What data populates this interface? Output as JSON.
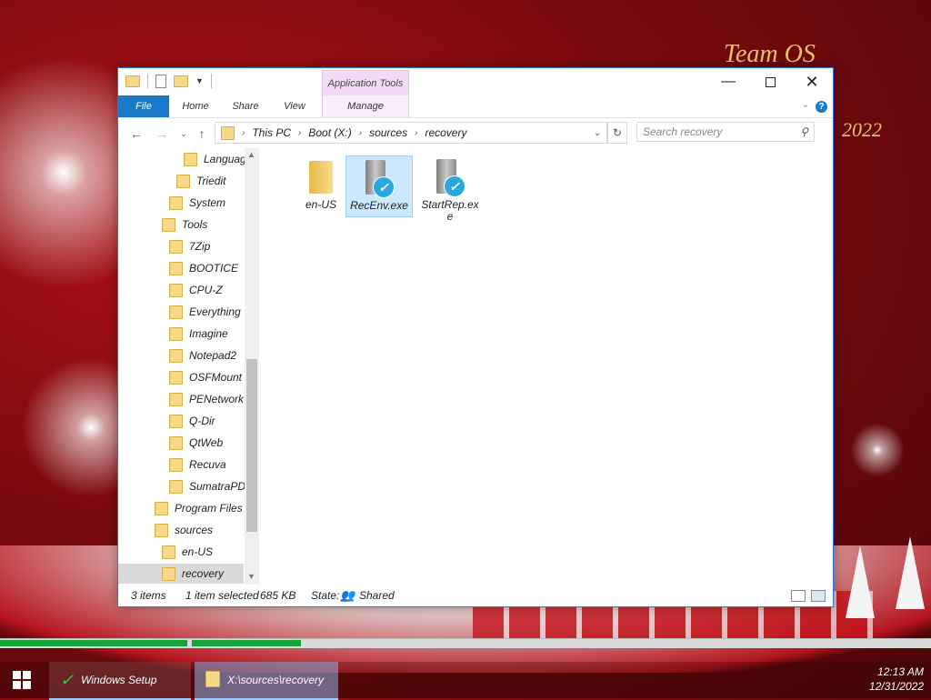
{
  "desktop": {
    "watermark_top": "Team OS",
    "watermark_year": "2022"
  },
  "window": {
    "quick_access_icons": [
      "folder-icon",
      "document-icon",
      "folder-icon",
      "dropdown-icon"
    ],
    "context_tab_group": "Application Tools",
    "ribbon_tabs": [
      "File",
      "Home",
      "Share",
      "View",
      "Manage"
    ],
    "controls": [
      "minimize",
      "maximize",
      "close"
    ]
  },
  "nav": {
    "address_segments": [
      "This PC",
      "Boot (X:)",
      "sources",
      "recovery"
    ],
    "search_placeholder": "Search recovery"
  },
  "tree": {
    "items": [
      {
        "label": "Languag",
        "level": 5
      },
      {
        "label": "Triedit",
        "level": 4
      },
      {
        "label": "System",
        "level": 3
      },
      {
        "label": "Tools",
        "level": 2
      },
      {
        "label": "7Zip",
        "level": 3
      },
      {
        "label": "BOOTICE",
        "level": 3
      },
      {
        "label": "CPU-Z",
        "level": 3
      },
      {
        "label": "Everything",
        "level": 3
      },
      {
        "label": "Imagine",
        "level": 3
      },
      {
        "label": "Notepad2",
        "level": 3
      },
      {
        "label": "OSFMount",
        "level": 3
      },
      {
        "label": "PENetwork",
        "level": 3
      },
      {
        "label": "Q-Dir",
        "level": 3
      },
      {
        "label": "QtWeb",
        "level": 3
      },
      {
        "label": "Recuva",
        "level": 3
      },
      {
        "label": "SumatraPD.",
        "level": 3
      },
      {
        "label": "Program Files (",
        "level": 1
      },
      {
        "label": "sources",
        "level": 1
      },
      {
        "label": "en-US",
        "level": 2
      },
      {
        "label": "recovery",
        "level": 2,
        "selected": true
      }
    ]
  },
  "files": [
    {
      "name": "en-US",
      "type": "folder",
      "selected": false
    },
    {
      "name": "RecEnv.exe",
      "type": "exe",
      "selected": true
    },
    {
      "name": "StartRep.exe",
      "type": "exe",
      "selected": false
    }
  ],
  "status": {
    "count": "3 items",
    "selection": "1 item selected",
    "size": "685 KB",
    "state_label": "State:",
    "state_value": "Shared"
  },
  "progress": {
    "stage1_fraction": 1.0,
    "stage2_fraction": 0.15
  },
  "taskbar": {
    "tasks": [
      "Windows Setup",
      "X:\\sources\\recovery"
    ],
    "time": "12:13 AM",
    "date": "12/31/2022"
  }
}
